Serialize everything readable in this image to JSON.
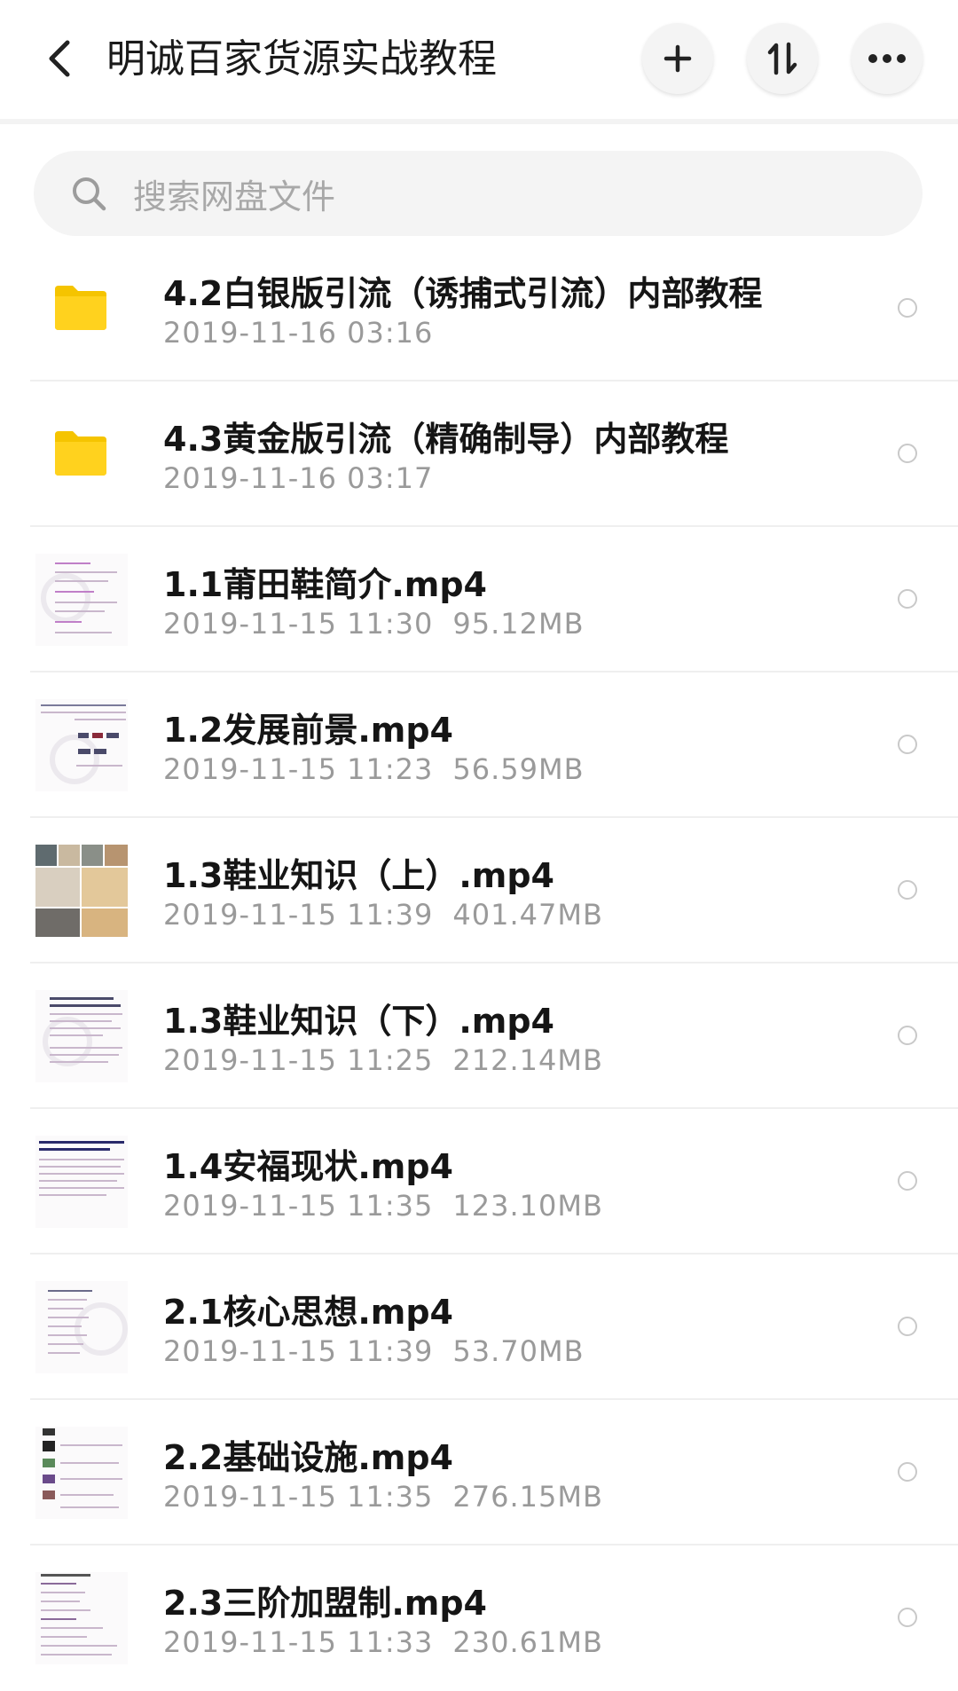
{
  "header": {
    "back_icon": "chevron-left-icon",
    "title": "明诚百家货源实战教程",
    "add_icon": "plus-icon",
    "sort_icon": "sort-arrows-icon",
    "more_icon": "more-dots-icon"
  },
  "search": {
    "placeholder": "搜索网盘文件",
    "icon": "search-icon"
  },
  "files": [
    {
      "name": "4.2白银版引流（诱捕式引流）内部教程",
      "date": "2019-11-16  03:16",
      "size": "",
      "type": "folder"
    },
    {
      "name": "4.3黄金版引流（精确制导）内部教程",
      "date": "2019-11-16  03:17",
      "size": "",
      "type": "folder"
    },
    {
      "name": "1.1莆田鞋简介.mp4",
      "date": "2019-11-15  11:30",
      "size": "95.12MB",
      "type": "video"
    },
    {
      "name": "1.2发展前景.mp4",
      "date": "2019-11-15  11:23",
      "size": "56.59MB",
      "type": "video"
    },
    {
      "name": "1.3鞋业知识（上）.mp4",
      "date": "2019-11-15  11:39",
      "size": "401.47MB",
      "type": "video"
    },
    {
      "name": "1.3鞋业知识（下）.mp4",
      "date": "2019-11-15  11:25",
      "size": "212.14MB",
      "type": "video"
    },
    {
      "name": "1.4安福现状.mp4",
      "date": "2019-11-15  11:35",
      "size": "123.10MB",
      "type": "video"
    },
    {
      "name": "2.1核心思想.mp4",
      "date": "2019-11-15  11:39",
      "size": "53.70MB",
      "type": "video"
    },
    {
      "name": "2.2基础设施.mp4",
      "date": "2019-11-15  11:35",
      "size": "276.15MB",
      "type": "video"
    },
    {
      "name": "2.3三阶加盟制.mp4",
      "date": "2019-11-15  11:33",
      "size": "230.61MB",
      "type": "video"
    }
  ],
  "colors": {
    "folder": "#FFD21E",
    "folder_tab": "#F5C400",
    "search_bg": "#F4F4F4",
    "placeholder": "#A8A8A8",
    "meta": "#9A9A9A"
  }
}
